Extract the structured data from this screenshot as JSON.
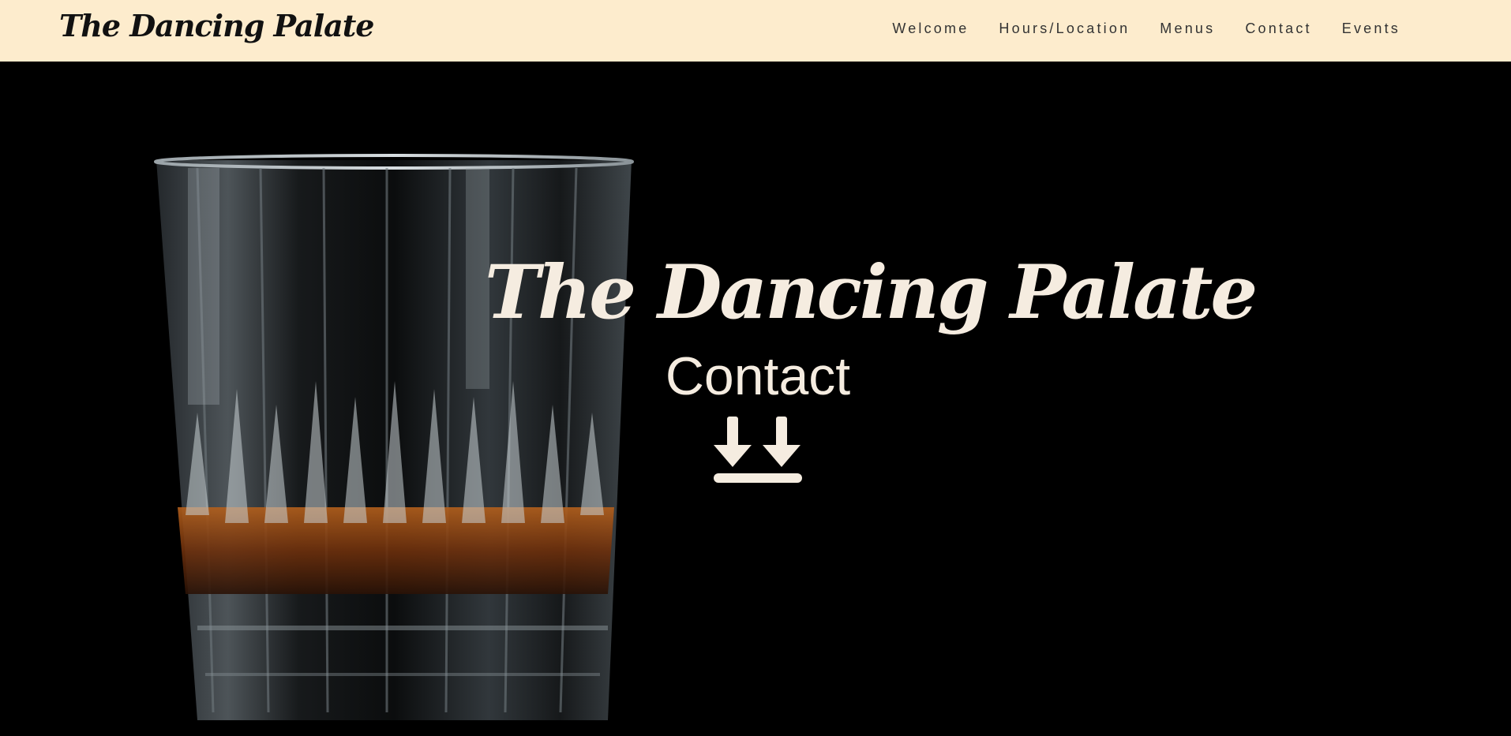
{
  "brand": {
    "name": "The Dancing Palate"
  },
  "nav": {
    "items": [
      {
        "label": "Welcome"
      },
      {
        "label": "Hours/Location"
      },
      {
        "label": "Menus"
      },
      {
        "label": "Contact"
      },
      {
        "label": "Events"
      }
    ]
  },
  "hero": {
    "title": "The Dancing Palate",
    "subtitle": "Contact",
    "scroll_icon": "double-down-arrow-icon"
  },
  "colors": {
    "navbar_bg": "#fdeccd",
    "hero_bg": "#000000",
    "hero_text": "#f5ece0",
    "brand_text": "#111111"
  }
}
